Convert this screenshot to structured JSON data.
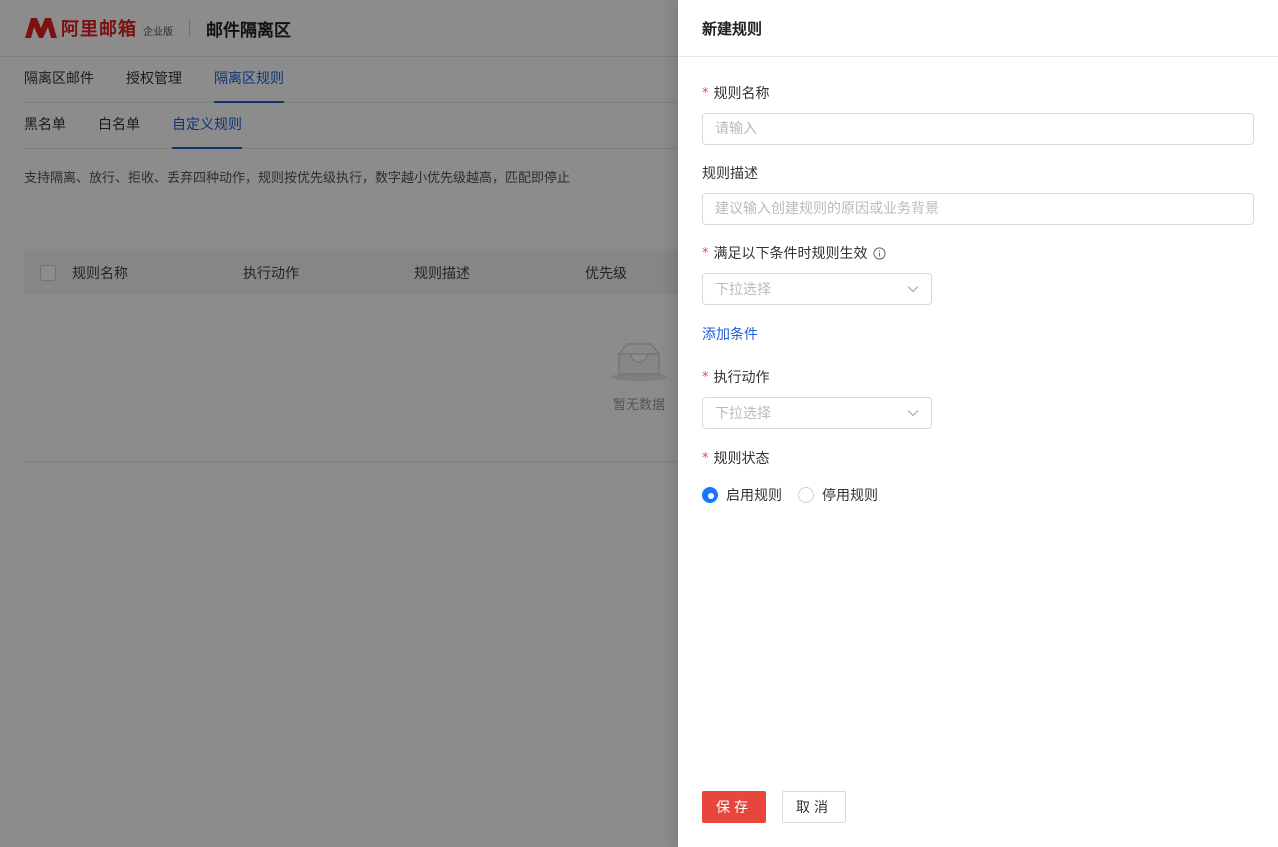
{
  "header": {
    "logo_text": "阿里邮箱",
    "logo_edition": "企业版",
    "app_title": "邮件隔离区"
  },
  "nav": {
    "tabs": [
      {
        "label": "隔离区邮件"
      },
      {
        "label": "授权管理"
      },
      {
        "label": "隔离区规则"
      }
    ]
  },
  "subnav": {
    "tabs": [
      {
        "label": "黑名单"
      },
      {
        "label": "白名单"
      },
      {
        "label": "自定义规则"
      }
    ]
  },
  "description": "支持隔离、放行、拒收、丢弃四种动作，规则按优先级执行，数字越小优先级越高，匹配即停止",
  "table": {
    "columns": [
      "规则名称",
      "执行动作",
      "规则描述",
      "优先级"
    ],
    "empty_text": "暂无数据"
  },
  "drawer": {
    "title": "新建规则",
    "rule_name": {
      "label": "规则名称",
      "placeholder": "请输入",
      "value": ""
    },
    "rule_desc": {
      "label": "规则描述",
      "placeholder": "建议输入创建规则的原因或业务背景",
      "value": ""
    },
    "conditions": {
      "label": "满足以下条件时规则生效",
      "placeholder": "下拉选择",
      "add_label": "添加条件"
    },
    "action": {
      "label": "执行动作",
      "placeholder": "下拉选择"
    },
    "status": {
      "label": "规则状态",
      "options": [
        {
          "label": "启用规则",
          "checked": true
        },
        {
          "label": "停用规则",
          "checked": false
        }
      ]
    },
    "save_label": "保存",
    "cancel_label": "取消"
  },
  "colors": {
    "brand": "#e02020",
    "accent": "#1f5fd6",
    "primary_button": "#e8453c",
    "radio_checked": "#1677ff"
  }
}
